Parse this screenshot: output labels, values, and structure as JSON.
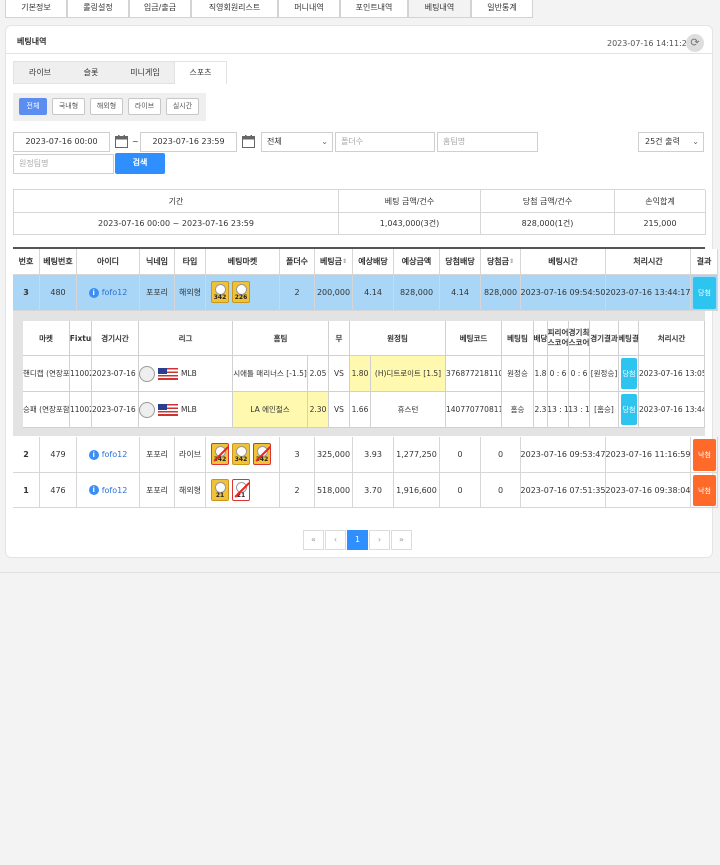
{
  "top_tabs": [
    "기본정보",
    "롤링설정",
    "입금/출금",
    "직영회원리스트",
    "머니내역",
    "포인트내역",
    "베팅내역",
    "일반통계"
  ],
  "section_title": "베팅내역",
  "timestamp": "2023-07-16 14:11:27",
  "sub_tabs": [
    "라이브",
    "슬롯",
    "미니게임",
    "스포츠"
  ],
  "filter_types": [
    "전체",
    "국내형",
    "해외형",
    "라이브",
    "실시간"
  ],
  "search": {
    "date_from": "2023-07-16 00:00",
    "date_to": "2023-07-16 23:59",
    "tilde": "~",
    "status_select": "전체",
    "folder_placeholder": "폴더수",
    "home_placeholder": "홈팀명",
    "away_placeholder": "원정팀명",
    "per_page": "25건 출력",
    "search_button": "검색"
  },
  "summary": {
    "headers": [
      "기간",
      "베팅 금액/건수",
      "당첨 금액/건수",
      "손익합계"
    ],
    "values": [
      "2023-07-16 00:00 ~ 2023-07-16 23:59",
      "1,043,000(3건)",
      "828,000(1건)",
      "215,000"
    ]
  },
  "bet_table": {
    "headers": [
      "번호",
      "베팅번호",
      "아이디",
      "닉네임",
      "타입",
      "베팅마켓",
      "폴더수",
      "베팅금",
      "예상배당",
      "예상금액",
      "당첨배당",
      "당첨금",
      "베팅시간",
      "처리시간",
      "결과"
    ],
    "sort_marks": "⇕",
    "rows": [
      {
        "no": "3",
        "bet_no": "480",
        "user": "fofo12",
        "nick": "포포리",
        "type": "해외형",
        "markets": [
          "342",
          "226"
        ],
        "folders": "2",
        "amount": "200,000",
        "odds": "4.14",
        "expected": "828,000",
        "win_odds": "4.14",
        "win_amount": "828,000",
        "bet_time": "2023-07-16 09:54:50",
        "proc_time": "2023-07-16 13:44:17",
        "result": "당첨"
      },
      {
        "no": "2",
        "bet_no": "479",
        "user": "fofo12",
        "nick": "포포리",
        "type": "라이브",
        "markets": [
          "342",
          "342",
          "342"
        ],
        "folders": "3",
        "amount": "325,000",
        "odds": "3.93",
        "expected": "1,277,250",
        "win_odds": "0",
        "win_amount": "0",
        "bet_time": "2023-07-16 09:53:47",
        "proc_time": "2023-07-16 11:16:59",
        "result": "낙첨"
      },
      {
        "no": "1",
        "bet_no": "476",
        "user": "fofo12",
        "nick": "포포리",
        "type": "해외형",
        "markets": [
          "21",
          "21"
        ],
        "folders": "2",
        "amount": "518,000",
        "odds": "3.70",
        "expected": "1,916,600",
        "win_odds": "0",
        "win_amount": "0",
        "bet_time": "2023-07-16 07:51:35",
        "proc_time": "2023-07-16 09:38:04",
        "result": "낙첨"
      }
    ]
  },
  "detail_table": {
    "headers": [
      "마켓",
      "Fixtu",
      "경기시간",
      "리그",
      "홈팀",
      "무",
      "원정팀",
      "베팅코드",
      "베팅팀",
      "배당",
      "피리어\n스코어",
      "경기최\n스코어",
      "경기결과",
      "베팅결",
      "처리시간"
    ],
    "rows": [
      {
        "market": "핸디캡 (연장포",
        "fixture": "11002",
        "time": "2023-07-16 1(",
        "league": "MLB",
        "home": "시애틀 매리너스 [-1.5]",
        "home_odds": "2.05",
        "vs": "VS",
        "away_odds": "1.80",
        "away": "(H)디트로이트 [1.5]",
        "code": "376877218110(",
        "bet_team": "원정승",
        "odds": "1.8",
        "period": "0 : 6",
        "final": "0 : 6",
        "game_result": "[원정승]",
        "bet_result": "당첨",
        "proc_time": "2023-07-16 13:05:07"
      },
      {
        "market": "승패 (연장포함",
        "fixture": "11002",
        "time": "2023-07-16 1(",
        "league": "MLB",
        "home": "LA 에인절스",
        "home_odds": "2.30",
        "vs": "VS",
        "away_odds": "1.66",
        "away": "휴스턴",
        "code": "140770770811(",
        "bet_team": "홈승",
        "odds": "2.3",
        "period": "13 : 1",
        "final": "13 : 1",
        "game_result": "[홈승]",
        "bet_result": "당첨",
        "proc_time": "2023-07-16 13:44:17"
      }
    ]
  },
  "pager": {
    "first": "«",
    "prev": "‹",
    "current": "1",
    "next": "›",
    "last": "»"
  },
  "colors": {
    "accent": "#2f8fff",
    "win": "#2ec4f0",
    "lose": "#ff6a2a",
    "highlight_row": "#a9d6f6"
  },
  "icons": [
    "calendar-icon",
    "refresh-icon",
    "info-icon",
    "baseball-icon",
    "us-flag-icon",
    "dropdown-chevron-icon"
  ]
}
